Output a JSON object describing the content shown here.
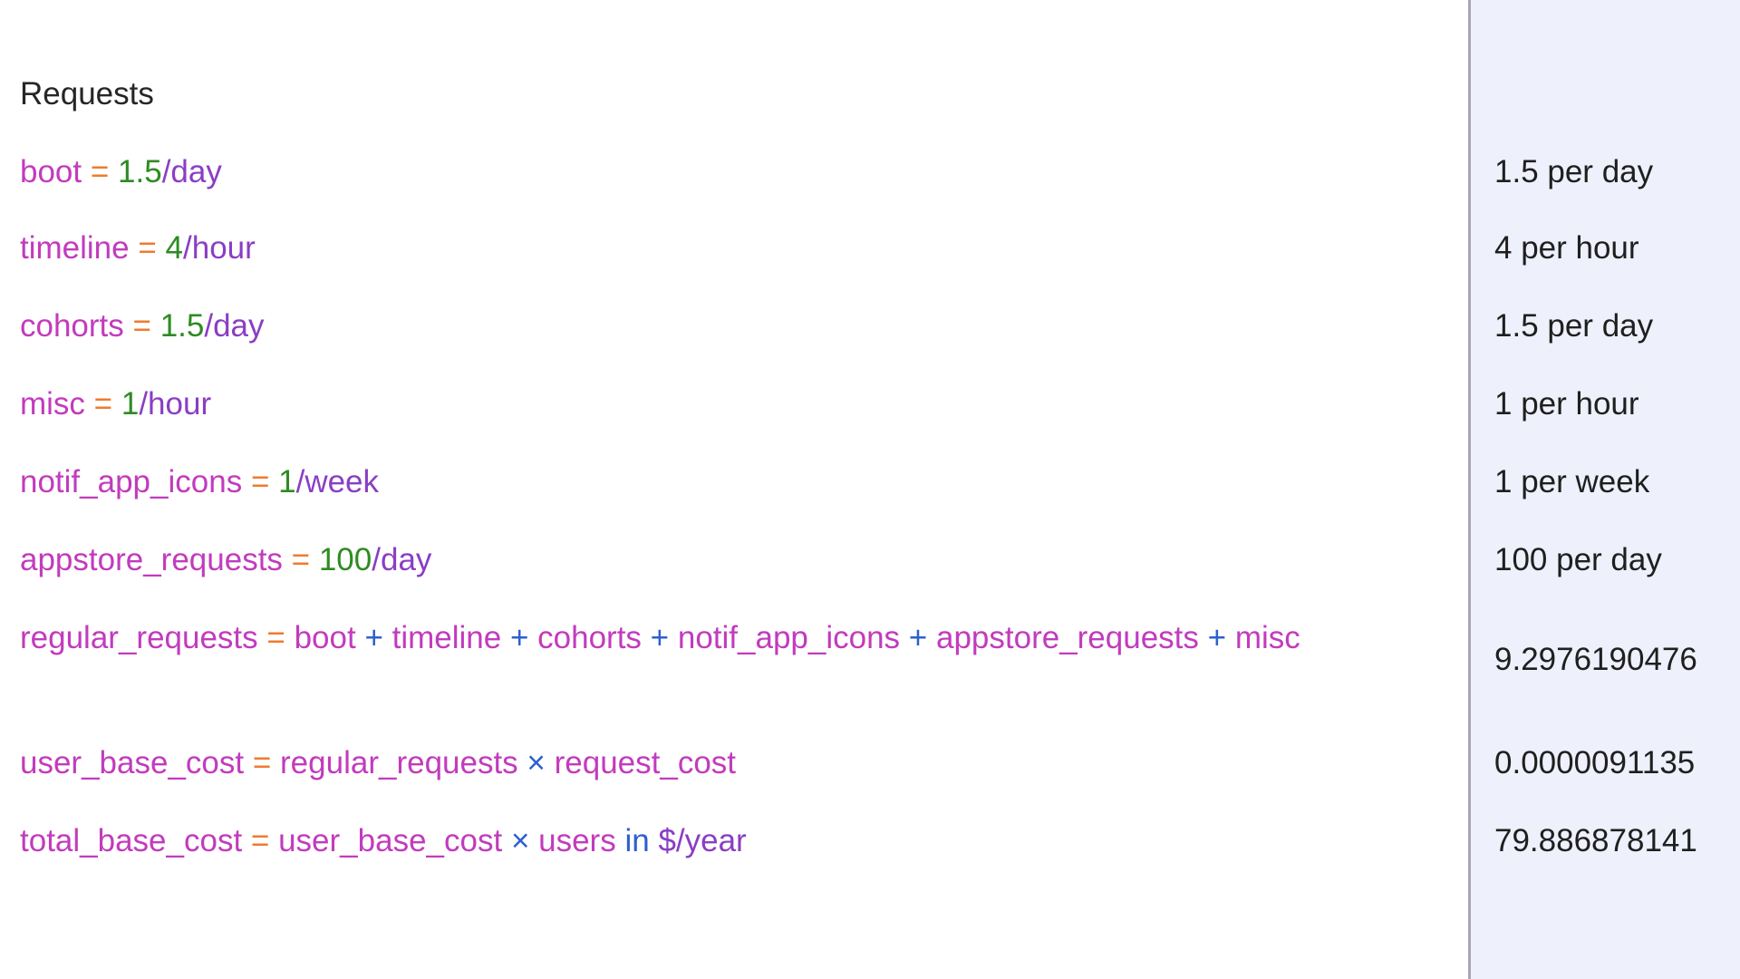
{
  "editor": {
    "heading": "Requests",
    "lines": [
      {
        "var": "boot",
        "eq": "=",
        "num": "1.5",
        "unit": "/day"
      },
      {
        "var": "timeline",
        "eq": "=",
        "num": "4",
        "unit": "/hour"
      },
      {
        "var": "cohorts",
        "eq": "=",
        "num": "1.5",
        "unit": "/day"
      },
      {
        "var": "misc",
        "eq": "=",
        "num": "1",
        "unit": "/hour"
      },
      {
        "var": "notif_app_icons",
        "eq": "=",
        "num": "1",
        "unit": "/week"
      },
      {
        "var": "appstore_requests",
        "eq": "=",
        "num": "100",
        "unit": "/day"
      }
    ],
    "regular_requests": {
      "var": "regular_requests",
      "eq": "=",
      "terms": [
        "boot",
        "timeline",
        "cohorts",
        "notif_app_icons",
        "appstore_requests",
        "misc"
      ],
      "op": "+"
    },
    "user_base_cost": {
      "var": "user_base_cost",
      "eq": "=",
      "lhs": "regular_requests",
      "op": "×",
      "rhs": "request_cost"
    },
    "total_base_cost": {
      "var": "total_base_cost",
      "eq": "=",
      "lhs": "user_base_cost",
      "op": "×",
      "rhs": "users",
      "kw": "in",
      "unit": "$/year"
    }
  },
  "results": [
    "1.5 per day",
    "4 per hour",
    "1.5 per day",
    "1 per hour",
    "1 per week",
    "100 per day",
    "9.2976190476",
    "0.0000091135",
    "79.886878141"
  ],
  "colors": {
    "variable": "#c23bbd",
    "equals": "#ee7b2d",
    "number": "#2e8b23",
    "unit": "#8a3ec4",
    "operator": "#2d5fcf",
    "results_bg": "#eef0fb",
    "divider": "#a7a7b2"
  }
}
